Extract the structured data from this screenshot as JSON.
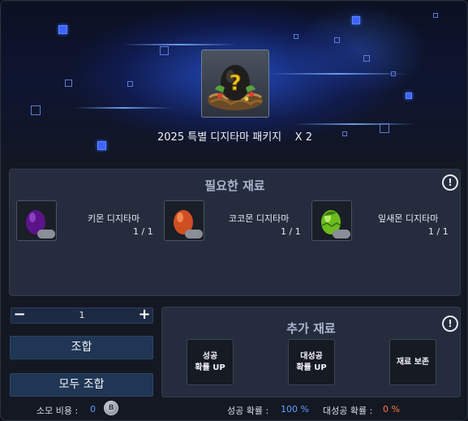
{
  "package": {
    "icon": "mystery-egg-nest",
    "title": "2025 특별 디지타마 패키지",
    "multiplier": "X 2"
  },
  "required_materials": {
    "title": "필요한 재료",
    "info_icon": "!",
    "items": [
      {
        "name": "키몬 디지타마",
        "count": "1 / 1",
        "icon": "purple-egg",
        "color": "#6a1a9a"
      },
      {
        "name": "코코몬 디지타마",
        "count": "1 / 1",
        "icon": "orange-egg",
        "color": "#d9572a"
      },
      {
        "name": "잎새몬 디지타마",
        "count": "1 / 1",
        "icon": "green-egg",
        "color": "#7cc823"
      }
    ]
  },
  "quantity": {
    "minus": "−",
    "value": "1",
    "plus": "+"
  },
  "buttons": {
    "combine": "조합",
    "combine_all": "모두 조합"
  },
  "extra_materials": {
    "title": "추가 재료",
    "info_icon": "!",
    "slots": [
      {
        "line1": "성공",
        "line2": "확률 UP"
      },
      {
        "line1": "대성공",
        "line2": "확률 UP"
      },
      {
        "line1": "재료 보존",
        "line2": ""
      }
    ]
  },
  "footer": {
    "cost_label": "소모 비용 :",
    "cost_value": "0",
    "coin_glyph": "B",
    "success_label": "성공 확률 :",
    "success_value": "100 %",
    "great_label": "대성공 확률 :",
    "great_value": "0 %"
  },
  "colors": {
    "accent_blue": "#5aa0ff",
    "accent_orange": "#ff7a3c",
    "button_bg": "#1f3654"
  }
}
